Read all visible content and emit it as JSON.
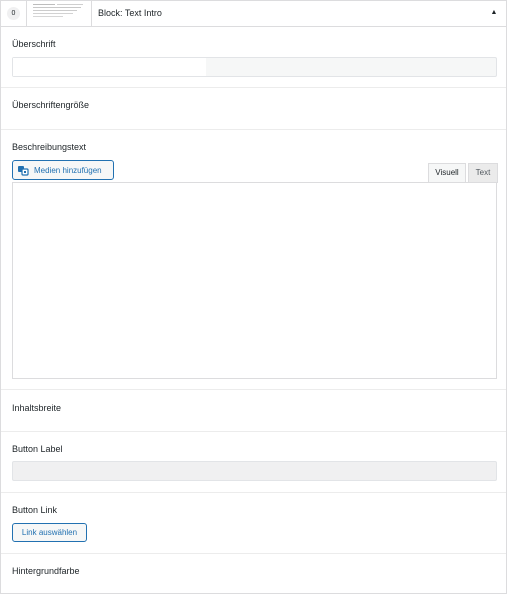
{
  "header": {
    "order_number": "0",
    "block_title": "Block: Text Intro",
    "collapse_glyph": "▲",
    "collapse_icon": "triangle-up-icon"
  },
  "fields": {
    "heading_label": "Überschrift",
    "heading_value": "",
    "heading_size_label": "Überschriftengröße",
    "description_label": "Beschreibungstext",
    "add_media_label": "Medien hinzufügen",
    "add_media_icon": "media-icon",
    "tab_visual": "Visuell",
    "tab_text": "Text",
    "editor_content": "",
    "content_width_label": "Inhaltsbreite",
    "button_label_label": "Button Label",
    "button_label_value": "",
    "button_link_label": "Button Link",
    "select_link_label": "Link auswählen",
    "background_color_label": "Hintergrundfarbe"
  },
  "colors": {
    "accent": "#2271b1",
    "border": "#dcdcde",
    "input_bg": "#f6f7f7"
  }
}
